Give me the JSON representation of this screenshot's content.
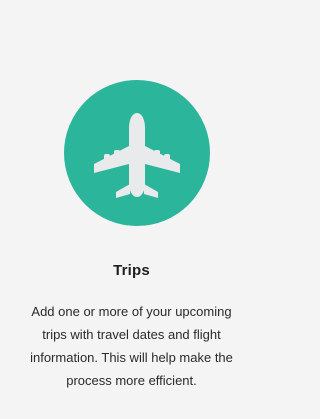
{
  "card": {
    "icon": "airplane-icon",
    "icon_bg_color": "#2bb59a",
    "title": "Trips",
    "description_lines": [
      "Add one or more of your upcoming",
      "trips with travel dates and flight",
      "information. This will help make the",
      "process more efficient."
    ]
  }
}
